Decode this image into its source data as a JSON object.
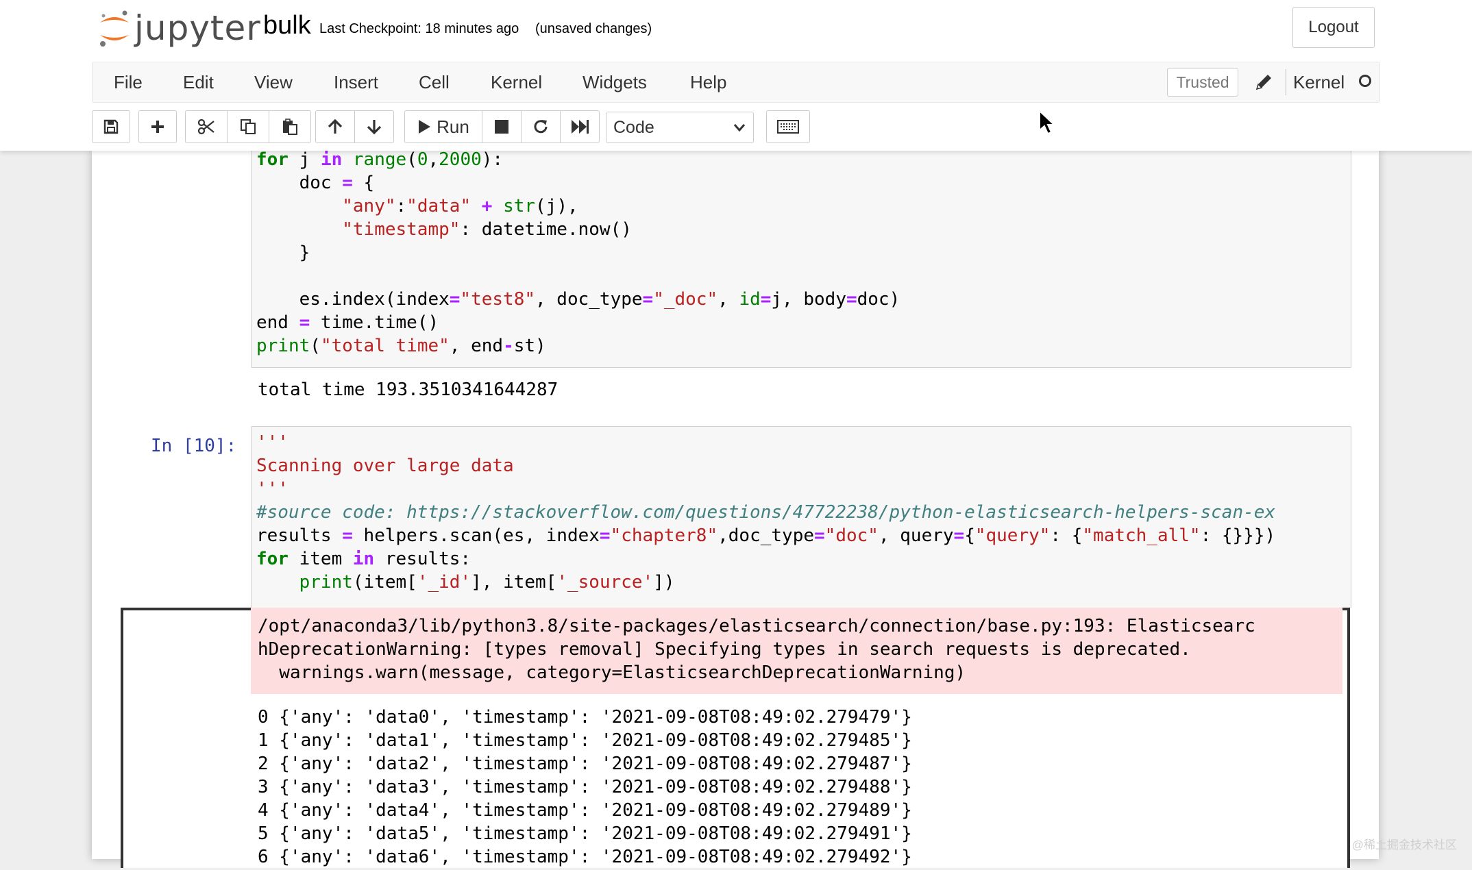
{
  "header": {
    "logo_text": "jupyter",
    "notebook_name": "bulk",
    "checkpoint": "Last Checkpoint: 18 minutes ago",
    "save_status": "(unsaved changes)",
    "logout_label": "Logout"
  },
  "menu": {
    "items": [
      "File",
      "Edit",
      "View",
      "Insert",
      "Cell",
      "Kernel",
      "Widgets",
      "Help"
    ],
    "trusted_label": "Trusted",
    "kernel_label": "Kernel"
  },
  "toolbar": {
    "run_label": "Run",
    "cell_type": "Code",
    "icons": [
      "save-icon",
      "plus-icon",
      "scissors-icon",
      "copy-icon",
      "paste-icon",
      "arrow-up-icon",
      "arrow-down-icon",
      "play-icon",
      "stop-icon",
      "restart-icon",
      "fast-forward-icon",
      "keyboard-icon"
    ]
  },
  "cell1": {
    "lines": [
      "for j in range(0,2000):",
      "    doc = {",
      "        \"any\":\"data\" + str(j),",
      "        \"timestamp\": datetime.now()",
      "    }",
      "",
      "    es.index(index=\"test8\", doc_type=\"_doc\", id=j, body=doc)",
      "end = time.time()",
      "print(\"total time\", end-st)"
    ],
    "output": "total time 193.3510341644287"
  },
  "cell2": {
    "prompt": "In [10]:",
    "lines": [
      "'''",
      "Scanning over large data",
      "'''",
      "#source code: https://stackoverflow.com/questions/47722238/python-elasticsearch-helpers-scan-ex",
      "results = helpers.scan(es, index=\"chapter8\",doc_type=\"doc\", query={\"query\": {\"match_all\": {}}})",
      "for item in results:",
      "    print(item['_id'], item['_source'])"
    ],
    "stderr": [
      "/opt/anaconda3/lib/python3.8/site-packages/elasticsearch/connection/base.py:193: Elasticsearc",
      "hDeprecationWarning: [types removal] Specifying types in search requests is deprecated.",
      "  warnings.warn(message, category=ElasticsearchDeprecationWarning)"
    ],
    "stdout": [
      "0 {'any': 'data0', 'timestamp': '2021-09-08T08:49:02.279479'}",
      "1 {'any': 'data1', 'timestamp': '2021-09-08T08:49:02.279485'}",
      "2 {'any': 'data2', 'timestamp': '2021-09-08T08:49:02.279487'}",
      "3 {'any': 'data3', 'timestamp': '2021-09-08T08:49:02.279488'}",
      "4 {'any': 'data4', 'timestamp': '2021-09-08T08:49:02.279489'}",
      "5 {'any': 'data5', 'timestamp': '2021-09-08T08:49:02.279491'}",
      "6 {'any': 'data6', 'timestamp': '2021-09-08T08:49:02.279492'}"
    ]
  },
  "watermark": "@稀土掘金技术社区"
}
